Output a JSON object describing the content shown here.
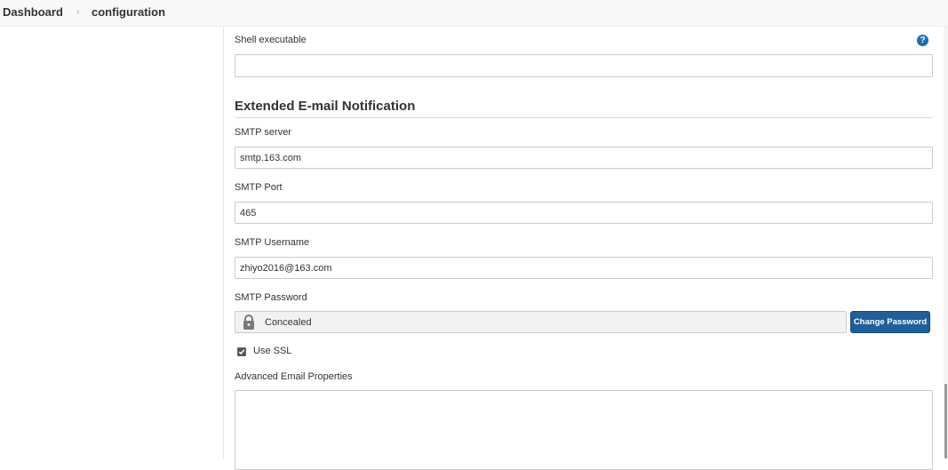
{
  "breadcrumb": {
    "items": [
      "Dashboard",
      "configuration"
    ],
    "separator": "›"
  },
  "shell": {
    "label": "Shell executable",
    "value": "",
    "help_icon": "question-circle-icon"
  },
  "email_section": {
    "title": "Extended E-mail Notification",
    "smtp_server": {
      "label": "SMTP server",
      "value": "smtp.163.com"
    },
    "smtp_port": {
      "label": "SMTP Port",
      "value": "465"
    },
    "smtp_username": {
      "label": "SMTP Username",
      "value": "zhiyo2016@163.com"
    },
    "smtp_password": {
      "label": "SMTP Password",
      "value": "Concealed",
      "icon": "lock-icon",
      "button_label": "Change Password"
    },
    "use_ssl": {
      "label": "Use SSL",
      "checked": true
    },
    "advanced_properties": {
      "label": "Advanced Email Properties",
      "value": ""
    }
  },
  "colors": {
    "accent": "#1f5f9b",
    "help_icon": "#1a6fb5",
    "breadcrumb_bg": "#f8f8f8"
  }
}
